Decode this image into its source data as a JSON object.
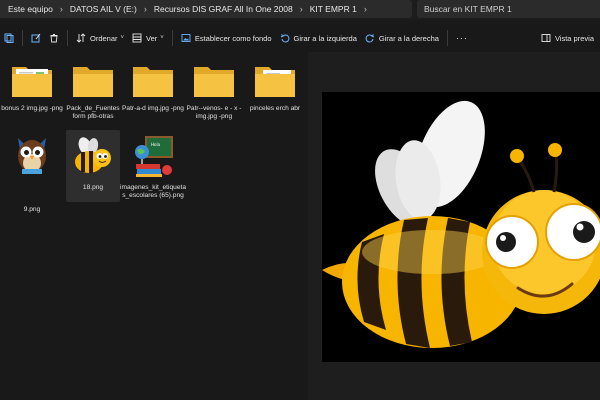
{
  "address": {
    "crumbs": [
      "Este equipo",
      "DATOS AIL V (E:)",
      "Recursos DIS GRAF All In One 2008",
      "KIT EMPR 1"
    ],
    "search_placeholder": "Buscar en KIT EMPR 1"
  },
  "toolbar": {
    "sort_label": "Ordenar",
    "view_label": "Ver",
    "set_background_label": "Establecer como fondo",
    "rotate_left_label": "Girar a la izquierda",
    "rotate_right_label": "Girar a la derecha",
    "more_label": "···",
    "preview_label": "Vista previa"
  },
  "files": [
    {
      "name": "bonus 2  img.jpg -png",
      "kind": "folder-doc"
    },
    {
      "name": "Pack_de_Fuentes form pfb-otras",
      "kind": "folder"
    },
    {
      "name": "Patr-a-d  img.jpg -png",
      "kind": "folder"
    },
    {
      "name": "Patr--venos- e - x - img.jpg -png",
      "kind": "folder"
    },
    {
      "name": "pinceles erch abr",
      "kind": "folder-doc"
    },
    {
      "name": "9.png",
      "kind": "owl"
    },
    {
      "name": "18.png",
      "kind": "bee",
      "selected": true
    },
    {
      "name": "imagenes_kit_etiquetas_escolares (65).png",
      "kind": "school"
    }
  ],
  "colors": {
    "background": "#191919",
    "folder": "#f5c242",
    "bee_yellow": "#f7b500",
    "bee_stripe": "#2a1a0c"
  }
}
